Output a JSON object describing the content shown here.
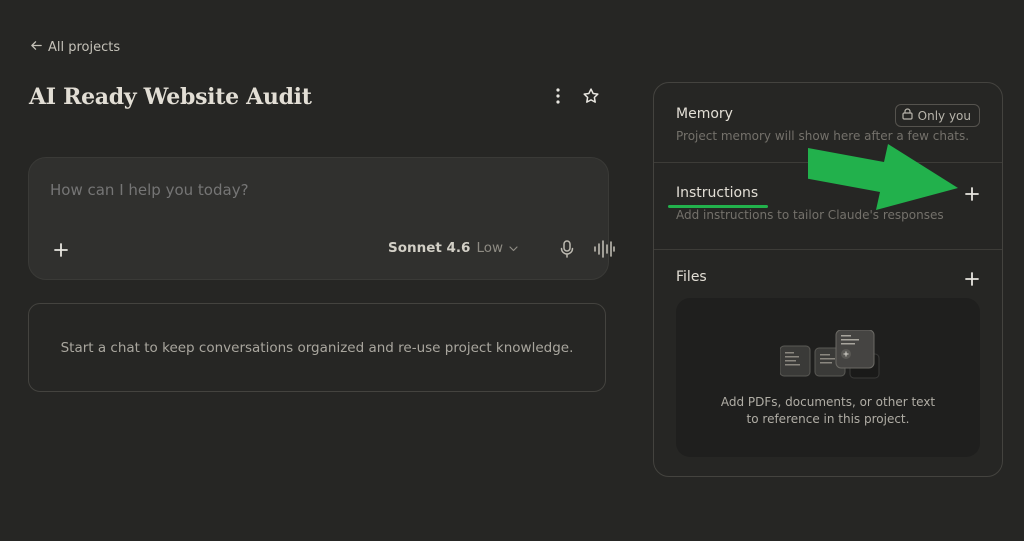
{
  "nav": {
    "back_label": "All projects"
  },
  "project": {
    "title": "AI Ready Website Audit"
  },
  "composer": {
    "placeholder": "How can I help you today?",
    "model": "Sonnet 4.6",
    "effort": "Low"
  },
  "empty_state": {
    "message": "Start a chat to keep conversations organized and re-use project knowledge."
  },
  "panel": {
    "memory": {
      "title": "Memory",
      "badge": "Only you",
      "description": "Project memory will show here after a few chats."
    },
    "instructions": {
      "title": "Instructions",
      "description": "Add instructions to tailor Claude's responses"
    },
    "files": {
      "title": "Files",
      "hint": "Add PDFs, documents, or other text to reference in this project."
    }
  },
  "colors": {
    "background": "#262624",
    "composer_bg": "#30302e",
    "annotation_green": "#22b14c"
  },
  "icons": [
    "arrow-left-icon",
    "more-vertical-icon",
    "star-icon",
    "plus-icon",
    "chevron-down-icon",
    "microphone-icon",
    "voice-waveform-icon",
    "lock-icon",
    "files-illustration-icon",
    "arrow-annotation-icon"
  ]
}
